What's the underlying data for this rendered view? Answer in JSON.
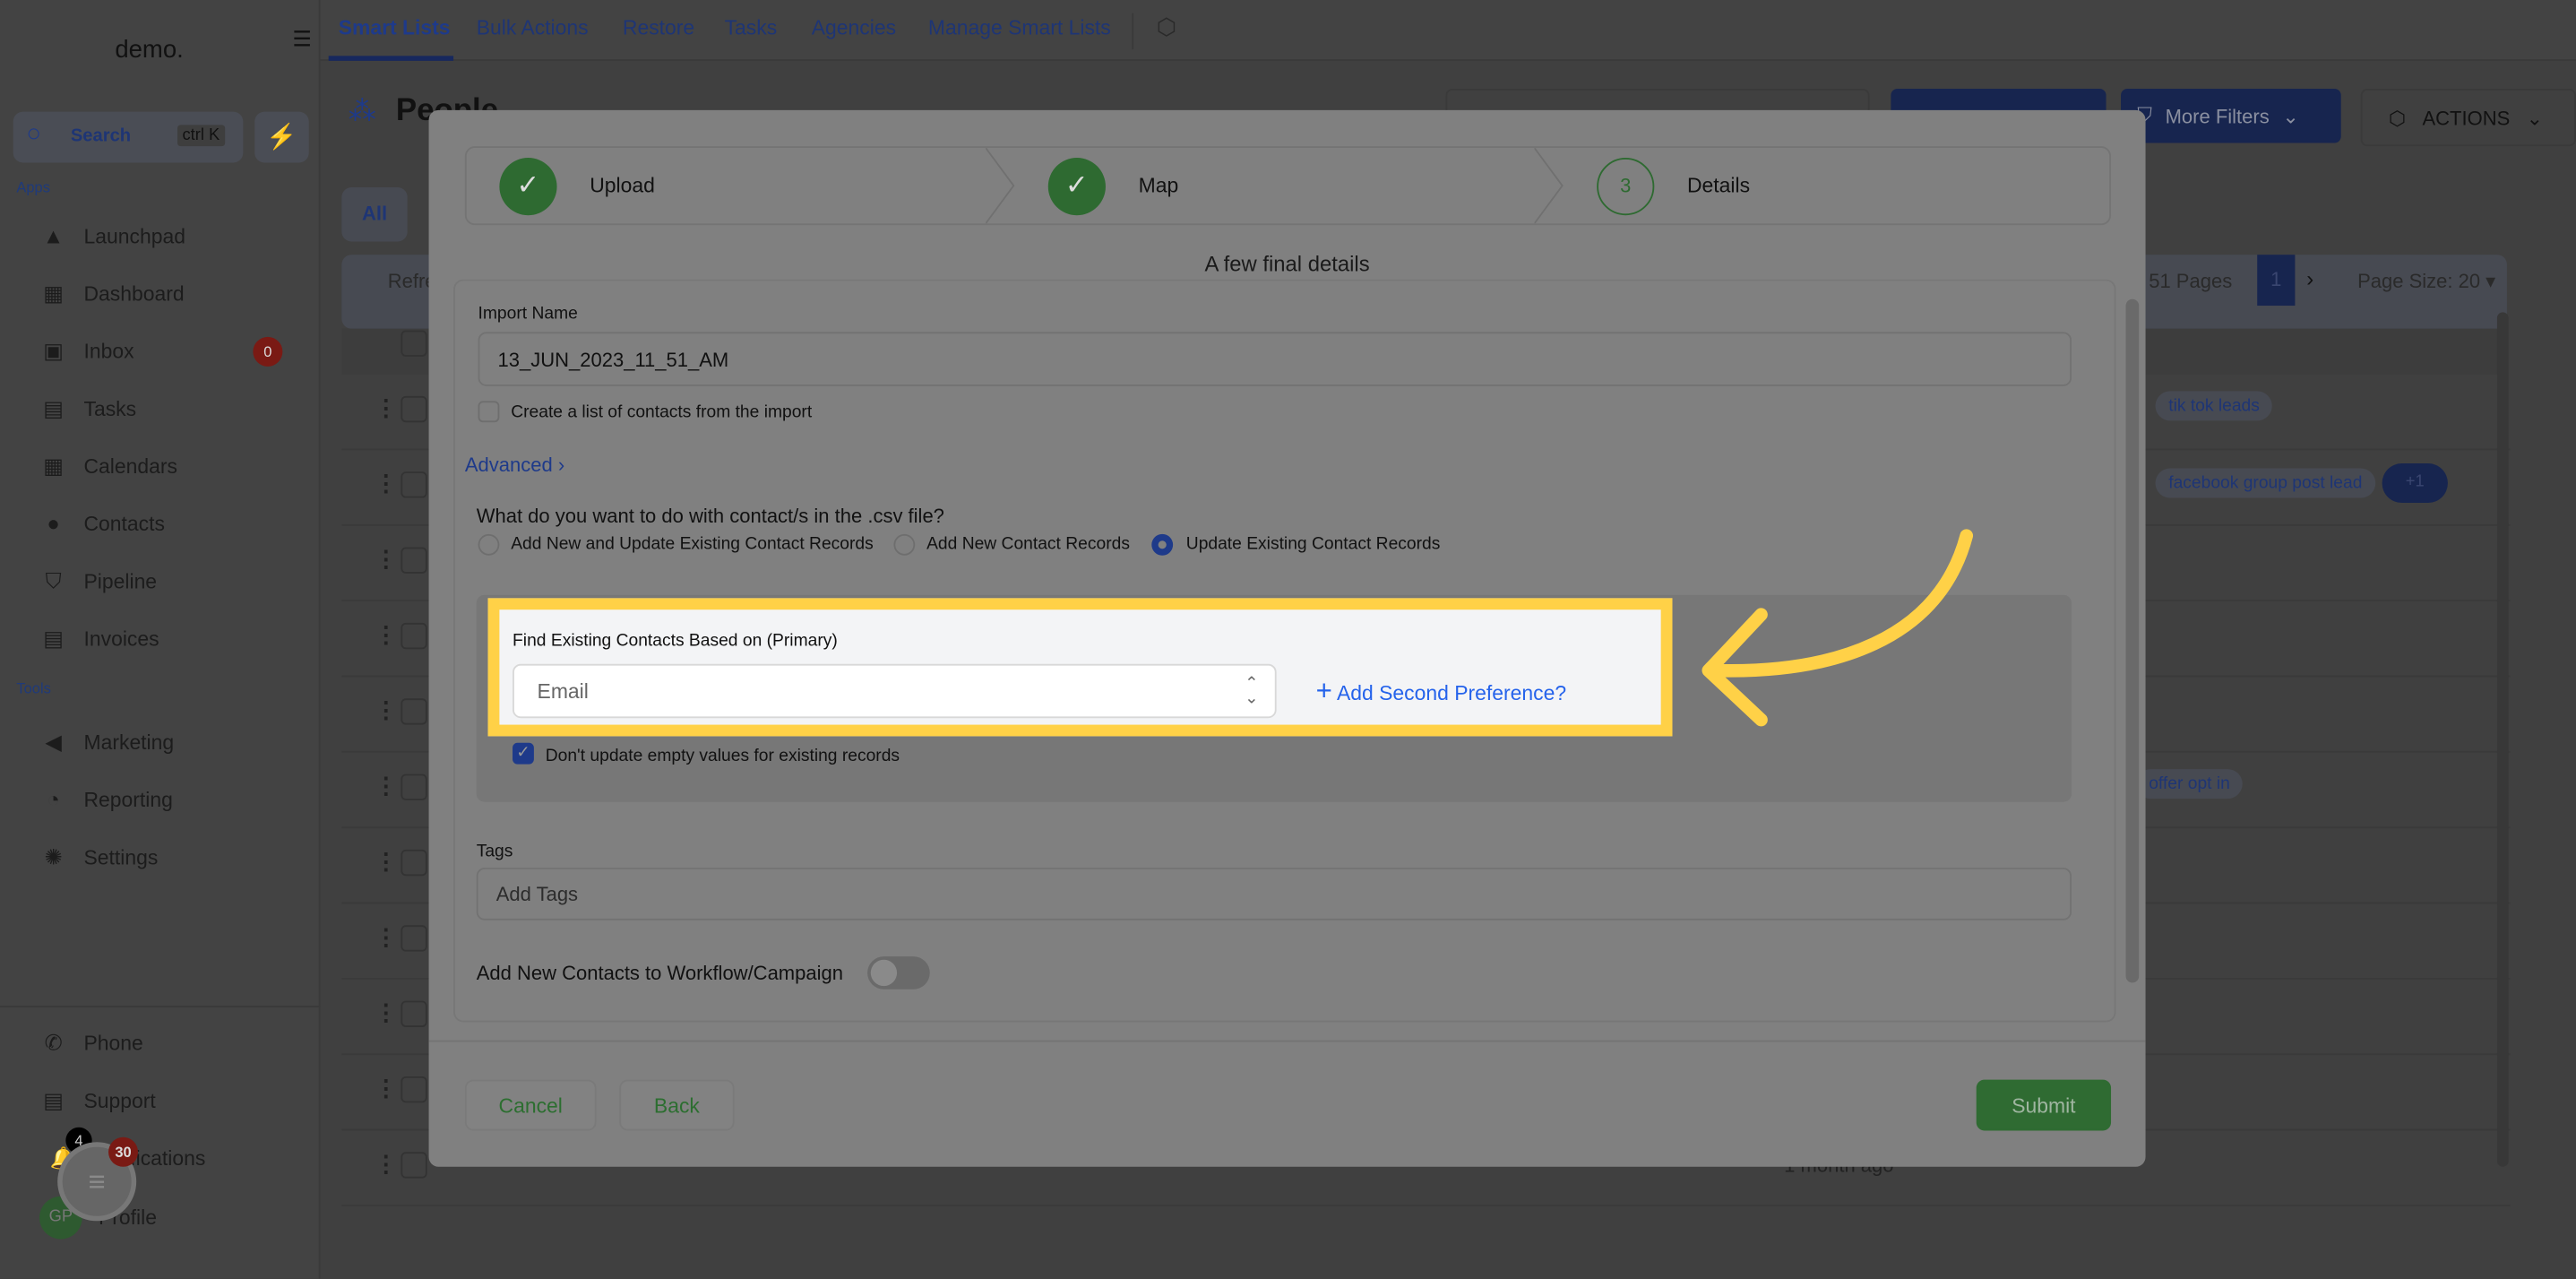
{
  "sidebar": {
    "logo": "demo.",
    "search_label": "Search",
    "search_shortcut": "ctrl K",
    "apps_label": "Apps",
    "tools_label": "Tools",
    "apps": [
      {
        "label": "Launchpad",
        "icon": "rocket-icon"
      },
      {
        "label": "Dashboard",
        "icon": "grid-icon"
      },
      {
        "label": "Inbox",
        "icon": "inbox-icon",
        "badge": "0"
      },
      {
        "label": "Tasks",
        "icon": "clipboard-icon"
      },
      {
        "label": "Calendars",
        "icon": "calendar-icon"
      },
      {
        "label": "Contacts",
        "icon": "user-icon"
      },
      {
        "label": "Pipeline",
        "icon": "funnel-icon"
      },
      {
        "label": "Invoices",
        "icon": "invoice-icon"
      }
    ],
    "tools": [
      {
        "label": "Marketing",
        "icon": "megaphone-icon"
      },
      {
        "label": "Reporting",
        "icon": "chart-icon"
      },
      {
        "label": "Settings",
        "icon": "gear-icon"
      }
    ],
    "bottom": [
      {
        "label": "Phone",
        "icon": "phone-icon"
      },
      {
        "label": "Support",
        "icon": "chat-icon"
      },
      {
        "label": "Notifications",
        "icon": "bell-icon",
        "badge": "4"
      },
      {
        "label": "Profile",
        "avatar": "GP"
      }
    ],
    "chat_widget_badge": "30"
  },
  "topnav": {
    "tabs": [
      "Smart Lists",
      "Bulk Actions",
      "Restore",
      "Tasks",
      "Agencies",
      "Manage Smart Lists"
    ],
    "active": "Smart Lists"
  },
  "page": {
    "title": "People",
    "more_filters": "More Filters",
    "actions": "ACTIONS",
    "all_tab": "All",
    "refresh": "Refre",
    "pages": "51 Pages",
    "current_page": "1",
    "page_size": "Page Size: 20",
    "tags": [
      "tik tok leads",
      "facebook group post lead",
      "offer opt in"
    ],
    "more_tags": "+1",
    "last_time": "1 month ago"
  },
  "modal": {
    "steps": [
      {
        "label": "Upload",
        "state": "done"
      },
      {
        "label": "Map",
        "state": "done"
      },
      {
        "label": "Details",
        "number": "3",
        "state": "current"
      }
    ],
    "subtitle": "A few final details",
    "import_name_label": "Import Name",
    "import_name_value": "13_JUN_2023_11_51_AM",
    "create_list_label": "Create a list of contacts from the import",
    "create_list_checked": false,
    "advanced_label": "Advanced",
    "question": "What do you want to do with contact/s in the .csv file?",
    "options": [
      "Add New and Update Existing Contact Records",
      "Add New Contact Records",
      "Update Existing Contact Records"
    ],
    "selected_option": "Update Existing Contact Records",
    "find_label": "Find Existing Contacts Based on (Primary)",
    "find_value": "Email",
    "add_second": "Add Second Preference?",
    "dont_update_label": "Don't update empty values for existing records",
    "dont_update_checked": true,
    "tags_label": "Tags",
    "tags_placeholder": "Add Tags",
    "workflow_label": "Add New Contacts to Workflow/Campaign",
    "workflow_on": false,
    "cancel": "Cancel",
    "back": "Back",
    "submit": "Submit"
  },
  "colors": {
    "highlight": "#ffd147",
    "success": "#3b8a3e",
    "link": "#2563eb",
    "accent": "#1e3a8a"
  }
}
